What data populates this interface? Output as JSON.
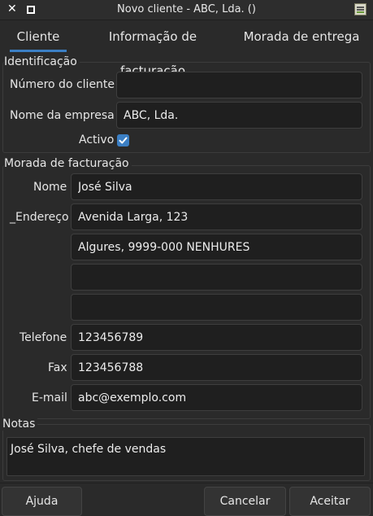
{
  "window": {
    "title": "Novo cliente - ABC, Lda. ()",
    "close_glyph": "✕",
    "close_icon": "close-icon",
    "maximize_icon": "maximize-icon",
    "app_icon": "spreadsheet-app-icon"
  },
  "tabs": [
    {
      "label": "Cliente",
      "active": true
    },
    {
      "label": "Informação de facturação",
      "active": false
    },
    {
      "label": "Morada de entrega",
      "active": false
    }
  ],
  "colors": {
    "accent": "#3b7fc4",
    "background": "#2a2a2a",
    "input_background": "#1f1f1f"
  },
  "identification": {
    "section_label": "Identificação",
    "customer_number_label": "Número do cliente",
    "customer_number_value": "",
    "company_name_label": "Nome da empresa",
    "company_name_value": "ABC, Lda.",
    "active_label": "Activo",
    "active_checked": true
  },
  "billing_address": {
    "section_label": "Morada de facturação",
    "name_label": "Nome",
    "name_value": "José Silva",
    "address_label": "_Endereço",
    "address_line1": "Avenida Larga, 123",
    "address_line2": "Algures, 9999-000 NENHURES",
    "address_line3": "",
    "address_line4": "",
    "phone_label": "Telefone",
    "phone_value": "123456789",
    "fax_label": "Fax",
    "fax_value": "123456788",
    "email_label": "E-mail",
    "email_value": "abc@exemplo.com"
  },
  "notes": {
    "section_label": "Notas",
    "value": "José Silva, chefe de vendas"
  },
  "buttons": {
    "help": "Ajuda",
    "cancel": "Cancelar",
    "accept": "Aceitar"
  }
}
